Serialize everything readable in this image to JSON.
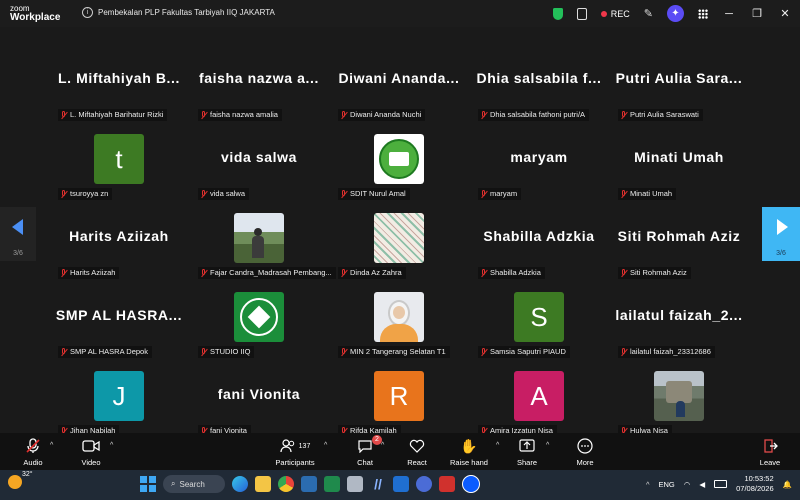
{
  "app": {
    "logo_line1": "zoom",
    "logo_line2": "Workplace",
    "meeting_title": "Pembekalan PLP Fakultas Tarbiyah IIQ JAKARTA",
    "rec": "REC"
  },
  "nav": {
    "left_page": "3/6",
    "right_page": "3/6"
  },
  "participants": [
    {
      "display": "L. Miftahiyah B...",
      "label": "L. Miftahiyah Barihatur Rizki",
      "type": "name"
    },
    {
      "display": "faisha nazwa a...",
      "label": "faisha nazwa amalia",
      "type": "name"
    },
    {
      "display": "Diwani Ananda...",
      "label": "Diwani Ananda Nuchi",
      "type": "name"
    },
    {
      "display": "Dhia salsabila f...",
      "label": "Dhia salsabila fathoni putri/A",
      "type": "name"
    },
    {
      "display": "Putri Aulia Sara...",
      "label": "Putri Aulia Saraswati",
      "type": "name"
    },
    {
      "display": "t",
      "label": "tsuroyya zn",
      "type": "avatar",
      "color": "#3d7a23"
    },
    {
      "display": "vida salwa",
      "label": "vida salwa",
      "type": "name"
    },
    {
      "display": "",
      "label": "SDIT Nurul Amal",
      "type": "logo-green"
    },
    {
      "display": "maryam",
      "label": "maryam",
      "type": "name"
    },
    {
      "display": "Minati Umah",
      "label": "Minati Umah",
      "type": "name"
    },
    {
      "display": "Harits Aziizah",
      "label": "Harits Aziizah",
      "type": "name"
    },
    {
      "display": "",
      "label": "Fajar Candra_Madrasah Pembang...",
      "type": "photo-landscape"
    },
    {
      "display": "",
      "label": "Dinda Az Zahra",
      "type": "photo-pattern"
    },
    {
      "display": "Shabilla Adzkia",
      "label": "Shabilla Adzkia",
      "type": "name"
    },
    {
      "display": "Siti Rohmah Aziz",
      "label": "Siti Rohmah Aziz",
      "type": "name"
    },
    {
      "display": "SMP AL HASRA...",
      "label": "SMP AL HASRA Depok",
      "type": "name"
    },
    {
      "display": "",
      "label": "STUDIO IIQ",
      "type": "logo-badge"
    },
    {
      "display": "",
      "label": "MIN 2 Tangerang Selatan T1",
      "type": "photo-person"
    },
    {
      "display": "S",
      "label": "Samsia Saputri PIAUD",
      "type": "avatar",
      "color": "#3d7a23"
    },
    {
      "display": "lailatul faizah_2...",
      "label": "lailatul faizah_23312686",
      "type": "name"
    },
    {
      "display": "J",
      "label": "Jihan Nabilah",
      "type": "avatar",
      "color": "#0d98a8"
    },
    {
      "display": "fani Vionita",
      "label": "fani Vionita",
      "type": "name"
    },
    {
      "display": "R",
      "label": "Rifda Kamilah",
      "type": "avatar",
      "color": "#e8741c"
    },
    {
      "display": "A",
      "label": "Amira Izzatun Nisa",
      "type": "avatar",
      "color": "#c81e64"
    },
    {
      "display": "",
      "label": "Hulwa Nisa",
      "type": "photo-outdoor"
    }
  ],
  "controls": {
    "audio": "Audio",
    "video": "Video",
    "participants": "Participants",
    "participants_count": "137",
    "chat": "Chat",
    "chat_badge": "2",
    "react": "React",
    "raise_hand": "Raise hand",
    "share": "Share",
    "more": "More",
    "leave": "Leave"
  },
  "taskbar": {
    "temp": "32°",
    "search": "Search",
    "lang": "ENG",
    "time": "10:53:52",
    "date": "07/08/2026"
  },
  "colors": {
    "accent": "#3fb7f4",
    "muted_mic": "#e0302e",
    "ai_button": "#5b4cf5"
  }
}
